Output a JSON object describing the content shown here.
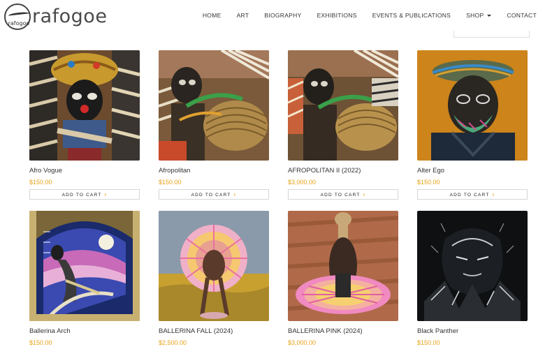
{
  "brand": {
    "logo_small": "rafogoe",
    "logo_word": "rafogoe"
  },
  "nav": {
    "items": [
      "HOME",
      "ART",
      "BIOGRAPHY",
      "EXHIBITIONS",
      "EVENTS & PUBLICATIONS",
      "SHOP",
      "CONTACT"
    ]
  },
  "colors": {
    "price": "#e8a317",
    "arrow": "#e8a317"
  },
  "cart_label": "ADD TO CART",
  "products": [
    {
      "title": "Afro Vogue",
      "price": "$150.00"
    },
    {
      "title": "Afropolitan",
      "price": "$150.00"
    },
    {
      "title": "AFROPOLITAN II (2022)",
      "price": "$3,000.00"
    },
    {
      "title": "Alter Ego",
      "price": "$150.00"
    },
    {
      "title": "Ballerina Arch",
      "price": "$150.00"
    },
    {
      "title": "BALLERINA FALL (2024)",
      "price": "$2,500.00"
    },
    {
      "title": "BALLERINA PINK (2024)",
      "price": "$3,000.00"
    },
    {
      "title": "Black Panther",
      "price": "$150.00"
    }
  ]
}
